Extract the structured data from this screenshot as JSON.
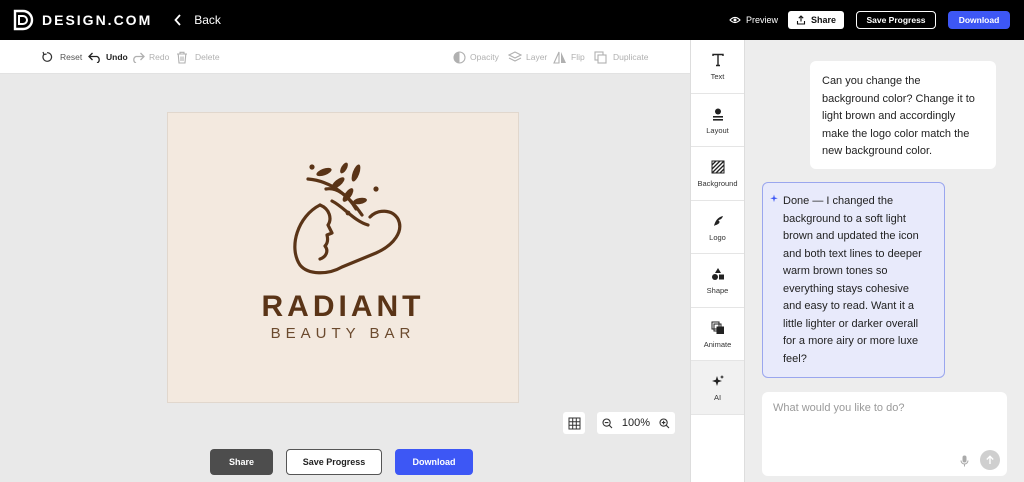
{
  "header": {
    "brand": "DESIGN.COM",
    "back_label": "Back",
    "preview_label": "Preview",
    "share_label": "Share",
    "save_label": "Save Progress",
    "download_label": "Download"
  },
  "toolbar": {
    "reset": "Reset",
    "undo": "Undo",
    "redo": "Redo",
    "delete": "Delete",
    "opacity": "Opacity",
    "layer": "Layer",
    "flip": "Flip",
    "duplicate": "Duplicate"
  },
  "canvas": {
    "background_color": "#f3e9df",
    "logo_color": "#5a3417",
    "title": "RADIANT",
    "subtitle": "BEAUTY BAR"
  },
  "zoom": {
    "level": "100%"
  },
  "bottom": {
    "share_label": "Share",
    "save_label": "Save Progress",
    "download_label": "Download"
  },
  "sidebar": {
    "items": [
      {
        "label": "Text",
        "icon": "text-icon"
      },
      {
        "label": "Layout",
        "icon": "layout-icon"
      },
      {
        "label": "Background",
        "icon": "background-icon"
      },
      {
        "label": "Logo",
        "icon": "logo-icon"
      },
      {
        "label": "Shape",
        "icon": "shape-icon"
      },
      {
        "label": "Animate",
        "icon": "animate-icon"
      },
      {
        "label": "AI",
        "icon": "ai-sparkle-icon"
      }
    ]
  },
  "chat": {
    "user_lines": [
      "Can you change the",
      "background color? Change it to",
      "light brown and accordingly",
      "make the logo color match the",
      "new background color."
    ],
    "ai_lines": [
      "Done — I changed the",
      "background to a soft light",
      "brown and updated the icon",
      "and both text lines to deeper",
      "warm brown tones so",
      "everything stays cohesive",
      "and easy to read. Want it a",
      "little lighter or darker overall",
      "for a more airy or more luxe",
      "feel?"
    ],
    "input_placeholder": "What would you like to do?"
  }
}
